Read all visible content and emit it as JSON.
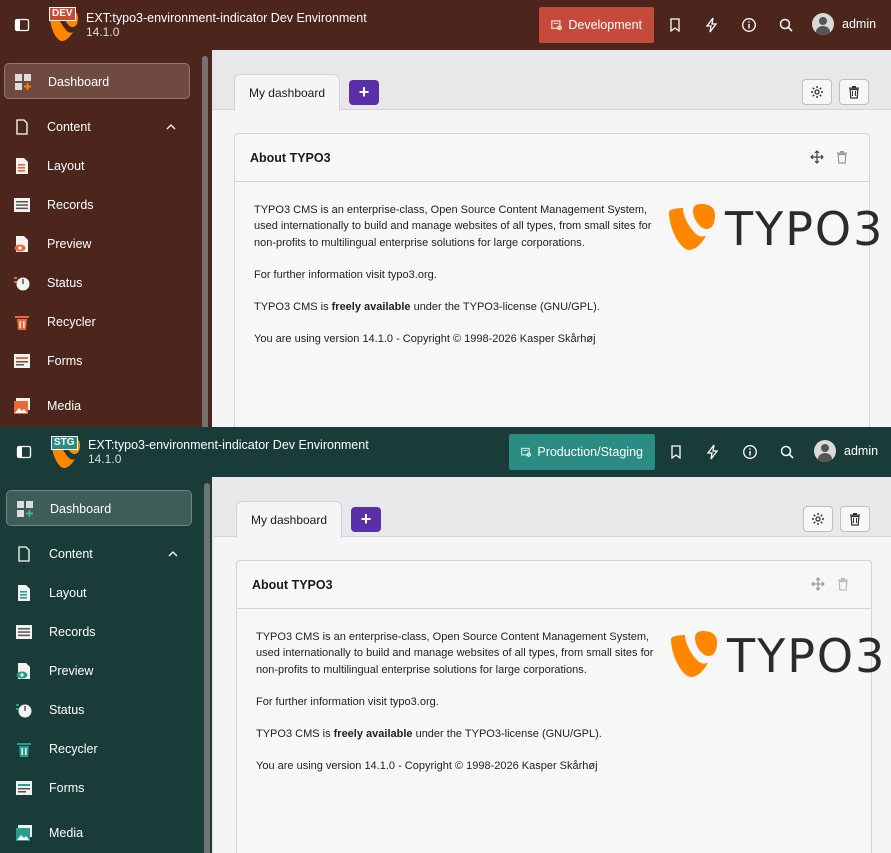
{
  "screens": {
    "dev": {
      "badge": "DEV",
      "title": "EXT:typo3-environment-indicator Dev Environment",
      "version": "14.1.0",
      "env_label": "Development",
      "user": "admin",
      "bar_color": "#4c261d",
      "env_color": "#c54a3a"
    },
    "stg": {
      "badge": "STG",
      "title": "EXT:typo3-environment-indicator Dev Environment",
      "version": "14.1.0",
      "env_label": "Production/Staging",
      "user": "admin",
      "bar_color": "#193c38",
      "env_color": "#2a8c82"
    }
  },
  "nav": {
    "dashboard": "Dashboard",
    "content": "Content",
    "layout": "Layout",
    "records": "Records",
    "preview": "Preview",
    "status": "Status",
    "recycler": "Recycler",
    "forms": "Forms",
    "media": "Media"
  },
  "dashboard": {
    "tab_label": "My dashboard",
    "add_label": "+"
  },
  "widget": {
    "title": "About TYPO3",
    "para1": "TYPO3 CMS is an enterprise-class, Open Source Content Management System, used internationally to build and manage websites of all types, from small sites for non-profits to multilingual enterprise solutions for large corporations.",
    "para2": "For further information visit typo3.org.",
    "para3_pre": "TYPO3 CMS is ",
    "para3_bold": "freely available",
    "para3_post": " under the TYPO3-license (GNU/GPL).",
    "para4": "You are using version 14.1.0 - Copyright © 1998-2026 Kasper Skårhøj",
    "logo_text": "TYPO3"
  },
  "colors": {
    "accent_purple": "#5b2fa8",
    "typo3_orange": "#ff8700"
  },
  "icons": [
    "sidebar-toggle-icon",
    "typo3-logo-icon",
    "bookmark-icon",
    "bolt-icon",
    "info-icon",
    "search-icon",
    "gear-icon",
    "trash-icon",
    "move-icon"
  ]
}
